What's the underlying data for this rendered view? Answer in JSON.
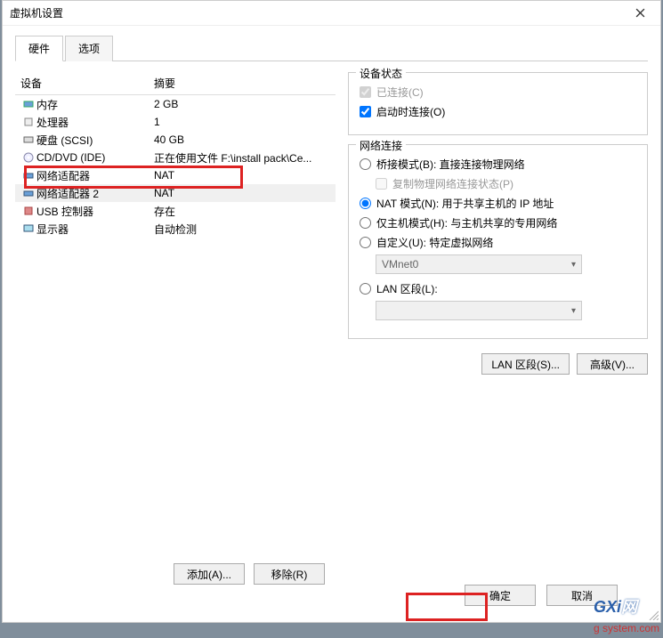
{
  "window": {
    "title": "虚拟机设置"
  },
  "tabs": {
    "hardware": "硬件",
    "options": "选项"
  },
  "columns": {
    "device": "设备",
    "summary": "摘要"
  },
  "devices": [
    {
      "name": "内存",
      "summary": "2 GB",
      "icon": "memory"
    },
    {
      "name": "处理器",
      "summary": "1",
      "icon": "cpu"
    },
    {
      "name": "硬盘 (SCSI)",
      "summary": "40 GB",
      "icon": "disk"
    },
    {
      "name": "CD/DVD (IDE)",
      "summary": "正在使用文件 F:\\install pack\\Ce...",
      "icon": "cd"
    },
    {
      "name": "网络适配器",
      "summary": "NAT",
      "icon": "net"
    },
    {
      "name": "网络适配器 2",
      "summary": "NAT",
      "icon": "net",
      "selected": true
    },
    {
      "name": "USB 控制器",
      "summary": "存在",
      "icon": "usb"
    },
    {
      "name": "显示器",
      "summary": "自动检测",
      "icon": "display"
    }
  ],
  "status": {
    "title": "设备状态",
    "connected": "已连接(C)",
    "connectOnStart": "启动时连接(O)"
  },
  "network": {
    "title": "网络连接",
    "bridged": "桥接模式(B): 直接连接物理网络",
    "replicate": "复制物理网络连接状态(P)",
    "nat": "NAT 模式(N): 用于共享主机的 IP 地址",
    "hostonly": "仅主机模式(H): 与主机共享的专用网络",
    "custom": "自定义(U): 特定虚拟网络",
    "customValue": "VMnet0",
    "lan": "LAN 区段(L):",
    "lanValue": ""
  },
  "buttons": {
    "lanSegments": "LAN 区段(S)...",
    "advanced": "高级(V)...",
    "add": "添加(A)...",
    "remove": "移除(R)",
    "ok": "确定",
    "cancel": "取消"
  },
  "watermark": {
    "part1": "GXi",
    "part2": "网",
    "part3": "g system.com"
  }
}
